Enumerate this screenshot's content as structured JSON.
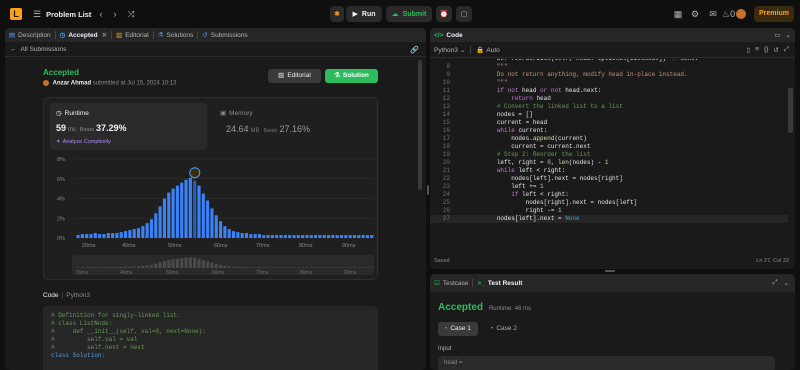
{
  "topbar": {
    "problem_list": "Problem List",
    "run": "Run",
    "submit": "Submit",
    "premium": "Premium",
    "notif": "0"
  },
  "left_tabs": [
    {
      "label": "Description",
      "icon": "description-icon"
    },
    {
      "label": "Accepted",
      "icon": "clock-icon"
    },
    {
      "label": "Editorial",
      "icon": "editorial-icon"
    },
    {
      "label": "Solutions",
      "icon": "solutions-icon"
    },
    {
      "label": "Submissions",
      "icon": "history-icon"
    }
  ],
  "submission": {
    "back": "All Submissions",
    "status": "Accepted",
    "user": "Anzar Ahmad",
    "submitted": "submitted at Jul 15, 2024 10:13",
    "editorial_btn": "Editorial",
    "solution_btn": "Solution",
    "runtime_title": "Runtime",
    "runtime_value": "59",
    "runtime_unit": "ms",
    "runtime_beats": "Beats",
    "runtime_pct": "37.29%",
    "analyze": "Analyze Complexity",
    "memory_title": "Memory",
    "memory_value": "24.64",
    "memory_unit": "MB",
    "memory_beats": "Beats",
    "memory_pct": "27.16%",
    "code_label": "Code",
    "code_lang": "Python3"
  },
  "chart_data": {
    "type": "bar",
    "yticks": [
      "8%",
      "6%",
      "4%",
      "2%",
      "0%"
    ],
    "ylim": [
      0,
      8
    ],
    "xticks": [
      "20ms",
      "40ms",
      "50ms",
      "60ms",
      "70ms",
      "80ms",
      "90ms"
    ],
    "mini_xticks": [
      "30ms",
      "40ms",
      "50ms",
      "60ms",
      "70ms",
      "80ms",
      "90ms"
    ],
    "values": [
      0.3,
      0.4,
      0.4,
      0.4,
      0.5,
      0.4,
      0.4,
      0.5,
      0.5,
      0.5,
      0.6,
      0.7,
      0.8,
      0.9,
      1.0,
      1.2,
      1.5,
      1.9,
      2.5,
      3.2,
      4.0,
      4.6,
      5.0,
      5.3,
      5.6,
      5.9,
      6.1,
      5.8,
      5.3,
      4.5,
      3.8,
      3.0,
      2.3,
      1.7,
      1.2,
      0.9,
      0.7,
      0.6,
      0.5,
      0.5,
      0.4,
      0.4,
      0.4,
      0.3,
      0.3,
      0.3,
      0.3,
      0.3,
      0.3,
      0.3,
      0.3,
      0.3,
      0.3,
      0.3,
      0.3,
      0.3,
      0.3,
      0.3,
      0.3,
      0.3,
      0.3,
      0.3,
      0.3,
      0.3,
      0.3,
      0.3,
      0.3,
      0.3,
      0.3
    ],
    "highlight_index": 27,
    "bar_color": "#3b82f6",
    "highlight_color": "#1e5fc7"
  },
  "left_code": [
    "# Definition for singly-linked list.",
    "# class ListNode:",
    "#     def __init__(self, val=0, next=None):",
    "#         self.val = val",
    "#         self.next = next",
    "class Solution:"
  ],
  "editor": {
    "title": "Code",
    "lang": "Python3",
    "auto": "Auto",
    "saved": "Saved",
    "cursor": "Ln 27, Col 32",
    "line_start": 8,
    "lines": [
      {
        "html": "<span class='va'>        def reorderList(self, head: Optional[ListNode]) -> None:</span>"
      },
      {
        "html": "<span class='st'>        \"\"\"</span>"
      },
      {
        "html": "<span class='st'>        Do not return anything, modify head in-place instead.</span>"
      },
      {
        "html": "<span class='st'>        \"\"\"</span>"
      },
      {
        "html": "        <span class='kw'>if not</span> <span class='va'>head</span> <span class='kw'>or not</span> <span class='va'>head.next:</span>"
      },
      {
        "html": "            <span class='kw'>return</span> <span class='va'>head</span>"
      },
      {
        "html": "        <span class='cm'># Convert the linked list to a list</span>"
      },
      {
        "html": "        <span class='va'>nodes = []</span>"
      },
      {
        "html": "        <span class='va'>current = head</span>"
      },
      {
        "html": "        <span class='kw'>while</span> <span class='va'>current:</span>"
      },
      {
        "html": "            <span class='va'>nodes.</span><span class='fn'>append</span><span class='va'>(current)</span>"
      },
      {
        "html": "            <span class='va'>current = current.next</span>"
      },
      {
        "html": "        <span class='cm'># Step 2: Reorder the list</span>"
      },
      {
        "html": "        <span class='va'>left, right = </span><span class='nm'>0</span><span class='va'>, </span><span class='fn'>len</span><span class='va'>(nodes) - </span><span class='nm'>1</span>"
      },
      {
        "html": "        <span class='kw'>while</span> <span class='va'>left &lt; right:</span>"
      },
      {
        "html": "            <span class='va'>nodes[left].next = nodes[right]</span>"
      },
      {
        "html": "            <span class='va'>left += </span><span class='nm'>1</span>"
      },
      {
        "html": "            <span class='kw'>if</span> <span class='va'>left &lt; right:</span>"
      },
      {
        "html": "                <span class='va'>nodes[right].next = nodes[left]</span>"
      },
      {
        "html": "                <span class='va'>right -= </span><span class='nm'>1</span>"
      },
      {
        "html": "        <span class='va'>nodes[left].next = </span><span class='bl'>None</span>"
      }
    ]
  },
  "testcase": {
    "tab1": "Testcase",
    "tab2": "Test Result",
    "status": "Accepted",
    "runtime": "Runtime: 46 ms",
    "case1": "Case 1",
    "case2": "Case 2",
    "input_label": "Input",
    "input_value": "head ="
  }
}
